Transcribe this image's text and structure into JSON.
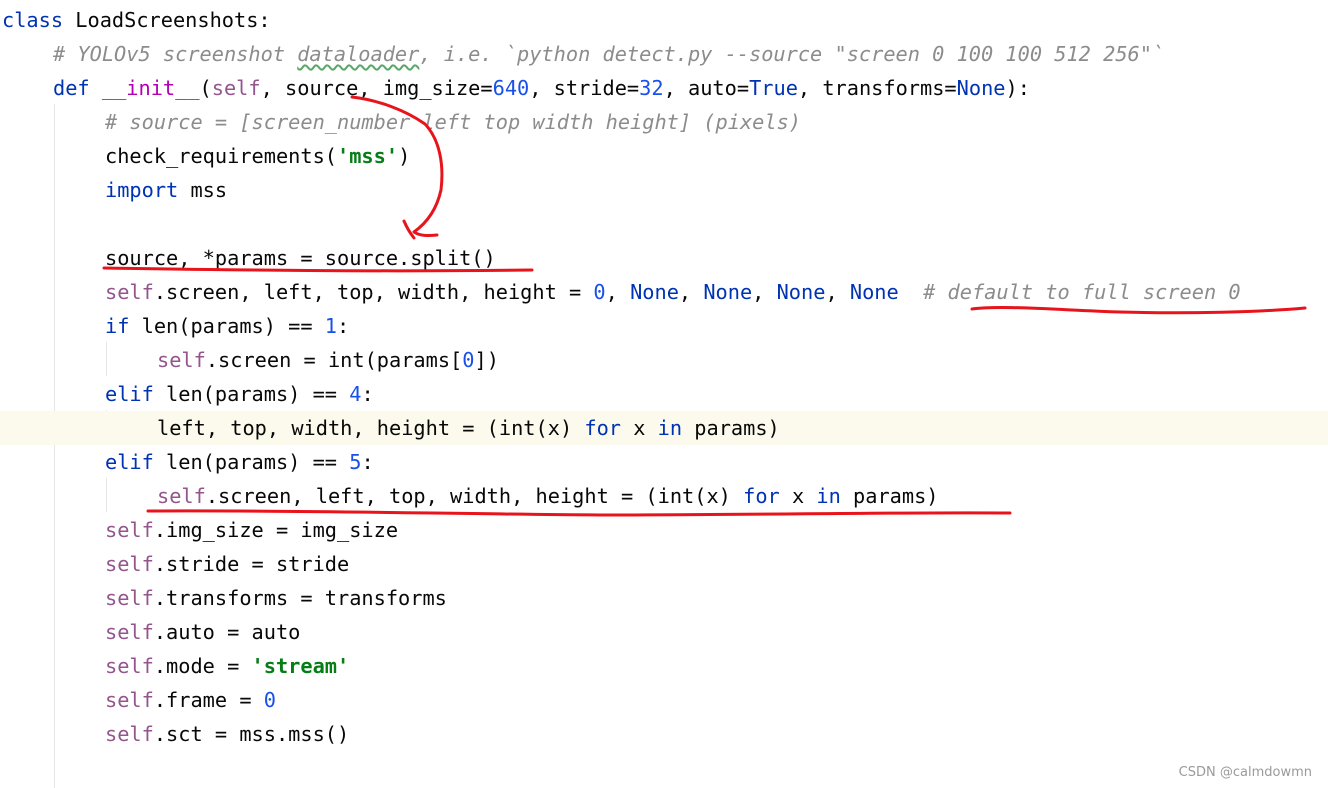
{
  "watermark": "CSDN @calmdowmn",
  "code": {
    "l1": {
      "kw": "class",
      "name": " LoadScreenshots:"
    },
    "l2": {
      "c1": "# YOLOv5 screenshot ",
      "c2": "dataloader",
      "c3": ", i.e. `python detect.py --source \"screen 0 100 100 512 256\"`"
    },
    "l3": {
      "kw": "def",
      "sp": " ",
      "fn": "__init__",
      "t1": "(",
      "self": "self",
      "t2": ", source, img_size=",
      "n1": "640",
      "t3": ", stride=",
      "n2": "32",
      "t4": ", auto=",
      "k1": "True",
      "t5": ", transforms=",
      "k2": "None",
      "t6": "):"
    },
    "l4": {
      "cmt": "# source = [screen_number left top width height] (pixels)"
    },
    "l5": {
      "t1": "check_requirements(",
      "str": "'mss'",
      "t2": ")"
    },
    "l6": {
      "kw": "import",
      "t": " mss"
    },
    "l8": {
      "t": "source, *params = source.split()"
    },
    "l9": {
      "self": "self",
      "t1": ".screen, left, top, width, height = ",
      "n": "0",
      "t2": ", ",
      "k1": "None",
      "t3": ", ",
      "k2": "None",
      "t4": ", ",
      "k3": "None",
      "t5": ", ",
      "k4": "None",
      "sp": "  ",
      "cmt": "# default to full screen 0"
    },
    "l10": {
      "kw": "if",
      "t1": " len(params) == ",
      "n": "1",
      "t2": ":"
    },
    "l11": {
      "self": "self",
      "t1": ".screen = int(params[",
      "n": "0",
      "t2": "])"
    },
    "l12": {
      "kw": "elif",
      "t1": " len(params) == ",
      "n": "4",
      "t2": ":"
    },
    "l13": {
      "t1": "left, top, width, height = (int(x) ",
      "k1": "for",
      "t2": " x ",
      "k2": "in",
      "t3": " params)"
    },
    "l14": {
      "kw": "elif",
      "t1": " len(params) == ",
      "n": "5",
      "t2": ":"
    },
    "l15": {
      "self": "self",
      "t1": ".screen, left, top, width, height = (int(x) ",
      "k1": "for",
      "t2": " x ",
      "k2": "in",
      "t3": " params)"
    },
    "l16": {
      "self": "self",
      "t": ".img_size = img_size"
    },
    "l17": {
      "self": "self",
      "t": ".stride = stride"
    },
    "l18": {
      "self": "self",
      "t": ".transforms = transforms"
    },
    "l19": {
      "self": "self",
      "t": ".auto = auto"
    },
    "l20": {
      "self": "self",
      "t1": ".mode = ",
      "str": "'stream'"
    },
    "l21": {
      "self": "self",
      "t1": ".frame = ",
      "n": "0"
    },
    "l22": {
      "self": "self",
      "t": ".sct = mss.mss()"
    }
  },
  "colors": {
    "background": "#ffffff",
    "current_line": "#fcfaed",
    "keyword": "#0033b3",
    "number": "#1750eb",
    "self": "#94558d",
    "string": "#067d17",
    "comment": "#8c8c8c",
    "annotation": "#e8141b"
  }
}
